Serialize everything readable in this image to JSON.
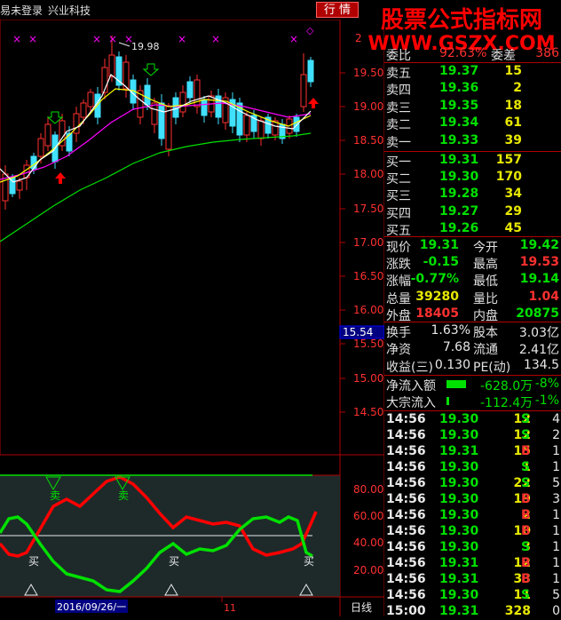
{
  "topbar": {
    "login_status": "易未登录",
    "stock_name": "兴业科技",
    "quote_button": "行 情"
  },
  "banner": {
    "title": "股票公式指标网",
    "url": "WWW.GSZX.COM"
  },
  "main_chart": {
    "y_ticks": [
      "2",
      "19.50",
      "19.00",
      "18.50",
      "18.00",
      "17.50",
      "17.00",
      "16.50",
      "16.00",
      "15.50",
      "15.00",
      "14.50"
    ],
    "high_label": "19.98",
    "cursor_price": "15.54"
  },
  "indicator": {
    "y_ticks": [
      "80.00",
      "60.00",
      "40.00",
      "20.00"
    ],
    "sell_labels": [
      "卖",
      "卖"
    ],
    "buy_labels": [
      "买",
      "买",
      "买"
    ]
  },
  "x_axis": {
    "date_label": "2016/09/26/一",
    "month_label": "11",
    "period": "日线"
  },
  "order_book": {
    "weibi": {
      "label": "委比",
      "value": "92.63%",
      "label2": "委差",
      "value2": "386"
    },
    "asks": [
      {
        "label": "卖五",
        "price": "19.37",
        "vol": "15"
      },
      {
        "label": "卖四",
        "price": "19.36",
        "vol": "2"
      },
      {
        "label": "卖三",
        "price": "19.35",
        "vol": "18"
      },
      {
        "label": "卖二",
        "price": "19.34",
        "vol": "61"
      },
      {
        "label": "卖一",
        "price": "19.33",
        "vol": "39"
      }
    ],
    "bids": [
      {
        "label": "买一",
        "price": "19.31",
        "vol": "157"
      },
      {
        "label": "买二",
        "price": "19.30",
        "vol": "170"
      },
      {
        "label": "买三",
        "price": "19.28",
        "vol": "34"
      },
      {
        "label": "买四",
        "price": "19.27",
        "vol": "29"
      },
      {
        "label": "买五",
        "price": "19.26",
        "vol": "45"
      }
    ]
  },
  "stats": {
    "xianjia": {
      "label": "现价",
      "value": "19.31",
      "label2": "今开",
      "value2": "19.42"
    },
    "zhangdie": {
      "label": "涨跌",
      "value": "-0.15",
      "label2": "最高",
      "value2": "19.53"
    },
    "zhangfu": {
      "label": "涨幅",
      "value": "-0.77%",
      "label2": "最低",
      "value2": "19.14"
    },
    "zongliang": {
      "label": "总量",
      "value": "39280",
      "label2": "量比",
      "value2": "1.04"
    },
    "waipan": {
      "label": "外盘",
      "value": "18405",
      "label2": "内盘",
      "value2": "20875"
    },
    "huanshou": {
      "label": "换手",
      "value": "1.63%",
      "label2": "股本",
      "value2": "3.03亿"
    },
    "jingzi": {
      "label": "净资",
      "value": "7.68",
      "label2": "流通",
      "value2": "2.41亿"
    },
    "shouyi": {
      "label": "收益(三)",
      "value": "0.130",
      "label2": "PE(动)",
      "value2": "134.5"
    }
  },
  "flows": {
    "net_inflow": {
      "label": "净流入额",
      "value": "-628.0万",
      "pct": "-8%"
    },
    "bulk_inflow": {
      "label": "大宗流入",
      "value": "-112.4万",
      "pct": "-1%"
    }
  },
  "trades": [
    {
      "time": "14:56",
      "price": "19.30",
      "vol": "12",
      "bs": "S",
      "n": "4",
      "price_color": "#00e000",
      "bs_color": "#00e000"
    },
    {
      "time": "14:56",
      "price": "19.30",
      "vol": "12",
      "bs": "S",
      "n": "2",
      "price_color": "#00e000",
      "bs_color": "#00e000"
    },
    {
      "time": "14:56",
      "price": "19.31",
      "vol": "15",
      "bs": "B",
      "n": "1",
      "price_color": "#00e000",
      "bs_color": "#ff3030"
    },
    {
      "time": "14:56",
      "price": "19.30",
      "vol": "1",
      "bs": "S",
      "n": "1",
      "price_color": "#00e000",
      "bs_color": "#00e000"
    },
    {
      "time": "14:56",
      "price": "19.30",
      "vol": "22",
      "bs": "S",
      "n": "5",
      "price_color": "#00e000",
      "bs_color": "#00e000"
    },
    {
      "time": "14:56",
      "price": "19.30",
      "vol": "19",
      "bs": "B",
      "n": "3",
      "price_color": "#00e000",
      "bs_color": "#ff3030"
    },
    {
      "time": "14:56",
      "price": "19.30",
      "vol": "2",
      "bs": "B",
      "n": "1",
      "price_color": "#00e000",
      "bs_color": "#ff3030"
    },
    {
      "time": "14:56",
      "price": "19.30",
      "vol": "10",
      "bs": "B",
      "n": "1",
      "price_color": "#00e000",
      "bs_color": "#ff3030"
    },
    {
      "time": "14:56",
      "price": "19.30",
      "vol": "3",
      "bs": "S",
      "n": "1",
      "price_color": "#00e000",
      "bs_color": "#00e000"
    },
    {
      "time": "14:56",
      "price": "19.31",
      "vol": "12",
      "bs": "B",
      "n": "1",
      "price_color": "#00e000",
      "bs_color": "#ff3030"
    },
    {
      "time": "14:56",
      "price": "19.31",
      "vol": "33",
      "bs": "B",
      "n": "1",
      "price_color": "#00e000",
      "bs_color": "#ff3030"
    },
    {
      "time": "14:56",
      "price": "19.30",
      "vol": "11",
      "bs": "S",
      "n": "5",
      "price_color": "#00e000",
      "bs_color": "#00e000"
    },
    {
      "time": "15:00",
      "price": "19.31",
      "vol": "328",
      "bs": "",
      "n": "0",
      "price_color": "#00e000",
      "bs_color": "#00e000"
    }
  ],
  "colors": {
    "up": "#ff3030",
    "down": "#00e000",
    "grid": "#b00000",
    "ma1": "#ffffff",
    "ma2": "#ffff00",
    "ma3": "#ff00ff",
    "ma4": "#00ff00"
  }
}
